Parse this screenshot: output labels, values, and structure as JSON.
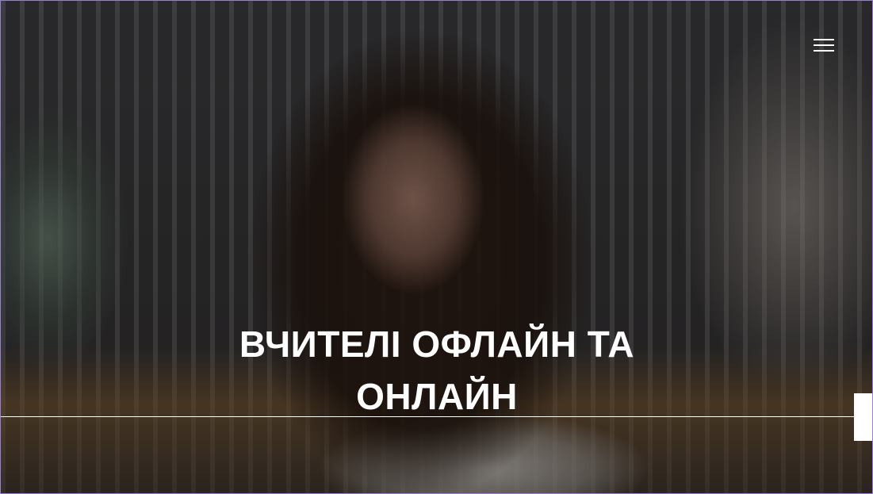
{
  "hero": {
    "title": "ВЧИТЕЛІ ОФЛАЙН ТА ОНЛАЙН",
    "overlay_color": "#000000",
    "text_color": "#ffffff"
  },
  "header": {
    "menu_icon": "hamburger-menu-icon"
  },
  "accent": {
    "frame_border": "#9a7fd6"
  }
}
